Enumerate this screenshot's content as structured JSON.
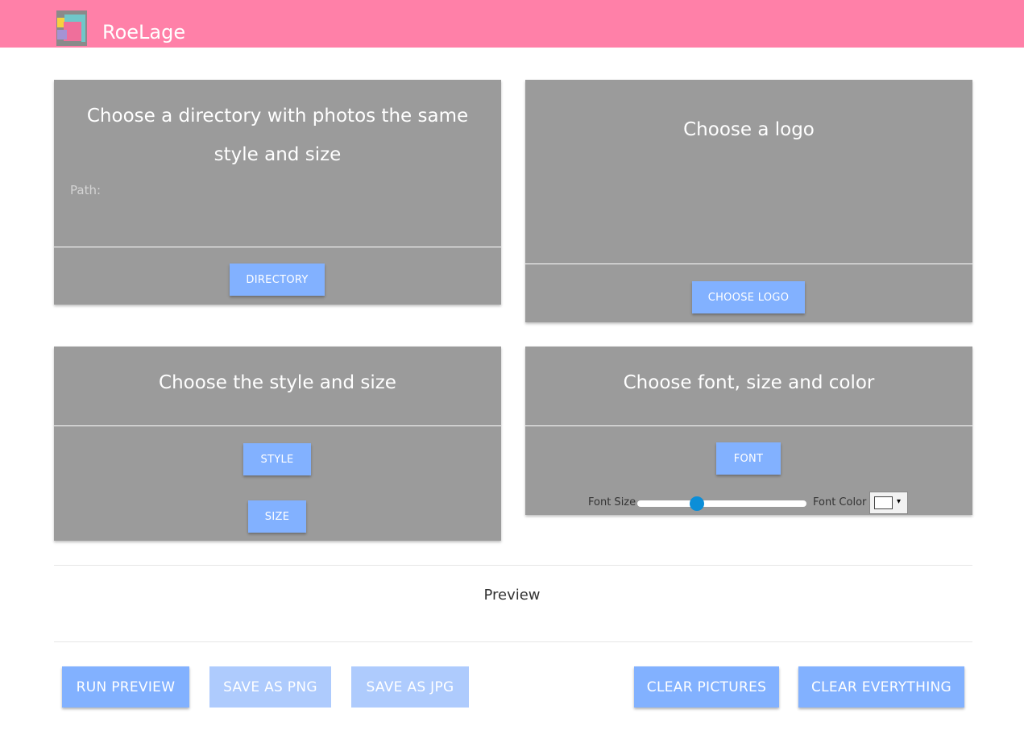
{
  "header": {
    "app_title": "RoeLage",
    "logo_icon": "collage-logo-icon",
    "background_color": "#ff80a8"
  },
  "directory_card": {
    "title": "Choose a directory with photos the same style and size",
    "path_label": "Path:",
    "button_label": "DIRECTORY"
  },
  "logo_card": {
    "title": "Choose a logo",
    "button_label": "CHOOSE LOGO"
  },
  "style_card": {
    "title": "Choose the style and size",
    "style_button_label": "STYLE",
    "size_button_label": "SIZE"
  },
  "font_card": {
    "title": "Choose font, size and color",
    "font_button_label": "FONT",
    "font_size_label": "Font Size",
    "font_size_fraction": 0.35,
    "font_color_label": "Font Color",
    "font_color_value": "#ffffff",
    "dropdown_glyph": "▾"
  },
  "preview": {
    "label": "Preview"
  },
  "actions": {
    "run_preview": "RUN PREVIEW",
    "save_png": "SAVE AS PNG",
    "save_jpg": "SAVE AS JPG",
    "clear_pictures": "CLEAR PICTURES",
    "clear_everything": "CLEAR EVERYTHING"
  },
  "colors": {
    "card": "#9b9b9b",
    "button": "#82b1ff",
    "button_disabled": "#aecbfd",
    "slider_thumb": "#0b8ed8"
  }
}
